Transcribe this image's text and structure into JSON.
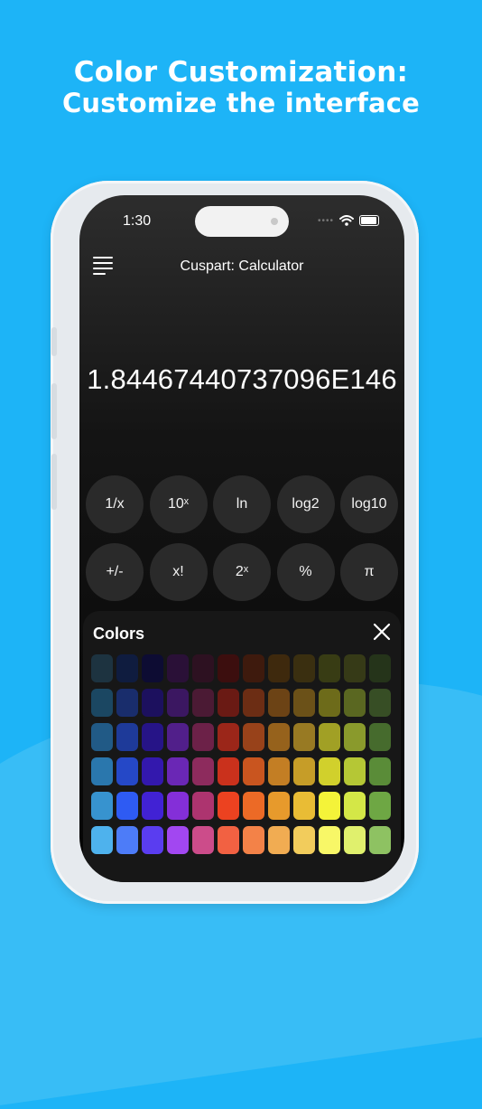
{
  "headline": {
    "line1": "Color Customization:",
    "line2": "Customize the interface"
  },
  "status_bar": {
    "time": "1:30",
    "icons": [
      "wifi-icon",
      "battery-icon"
    ]
  },
  "app": {
    "title": "Cuspart: Calculator",
    "menu_icon": "hamburger-menu-icon",
    "display_value": "1.84467440737096E146"
  },
  "keys": {
    "row1": [
      "1/x",
      "10ˣ",
      "ln",
      "log2",
      "log10"
    ],
    "row2": [
      "+/-",
      "x!",
      "2ˣ",
      "%",
      "π"
    ]
  },
  "colors_panel": {
    "title": "Colors",
    "close_icon": "close-icon",
    "swatches": [
      [
        "#1d3340",
        "#0f1c3f",
        "#0d0c33",
        "#2a1037",
        "#2d1121",
        "#3c0e0e",
        "#3e1a0d",
        "#3e290d",
        "#3a2f10",
        "#383c14",
        "#363a17",
        "#25341a"
      ],
      [
        "#1b4762",
        "#192d6c",
        "#1c105e",
        "#3b1761",
        "#4b1a34",
        "#6a1a14",
        "#6c2d14",
        "#6c4315",
        "#6b5118",
        "#6d6b1a",
        "#5a6721",
        "#374e25"
      ],
      [
        "#215a86",
        "#1e3a99",
        "#261487",
        "#511f8a",
        "#6c2148",
        "#9b2619",
        "#98421a",
        "#96621c",
        "#987a23",
        "#a1a025",
        "#8a9a2c",
        "#466b2d"
      ],
      [
        "#2a77ad",
        "#2548c7",
        "#3318ad",
        "#6a27b5",
        "#8d2b5d",
        "#ca311c",
        "#c9551f",
        "#c37e24",
        "#c69d28",
        "#d1d02c",
        "#b5c735",
        "#5a8c38"
      ],
      [
        "#3793cf",
        "#2e5bf3",
        "#4122d4",
        "#842fd8",
        "#ad346f",
        "#ec4220",
        "#ec6a26",
        "#e79a2c",
        "#e9bc35",
        "#f4f339",
        "#d4e747",
        "#6ea744"
      ],
      [
        "#4eb2ed",
        "#4d7cf8",
        "#5a3df0",
        "#a247f1",
        "#cc4c8a",
        "#f26142",
        "#f38248",
        "#f1ac52",
        "#f2cc5c",
        "#f8f767",
        "#e0f06d",
        "#8ec262"
      ]
    ]
  }
}
